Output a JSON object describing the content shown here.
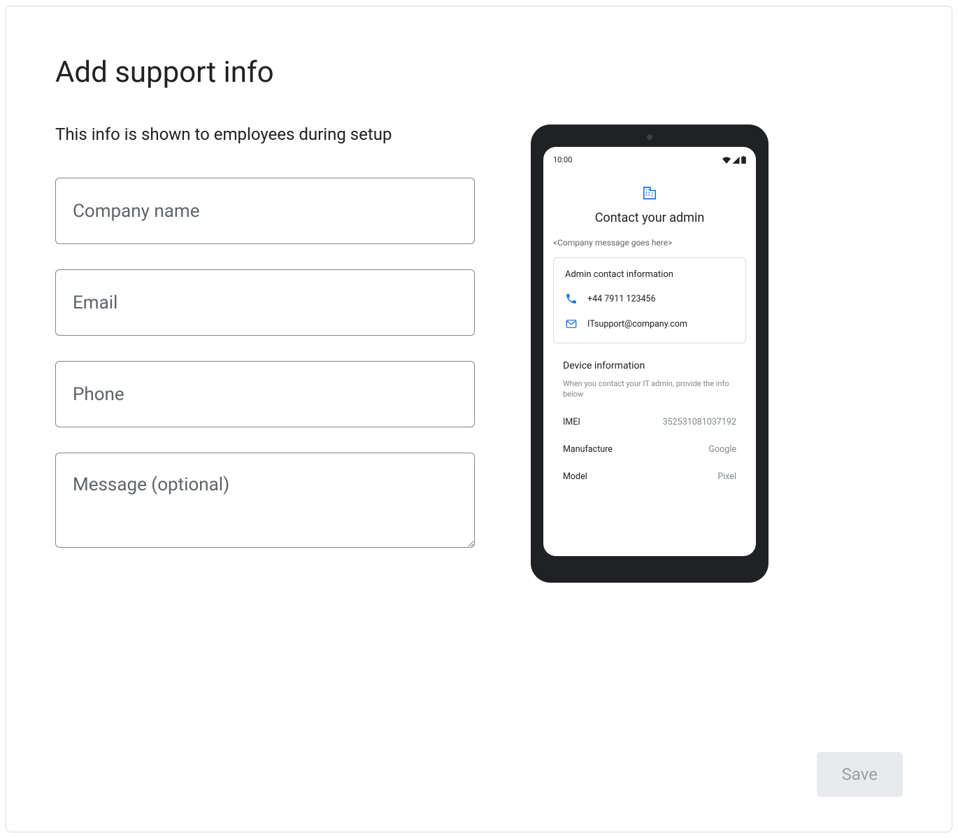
{
  "page": {
    "title": "Add support info",
    "subtitle": "This info is shown to employees during setup"
  },
  "form": {
    "company_placeholder": "Company name",
    "email_placeholder": "Email",
    "phone_placeholder": "Phone",
    "message_placeholder": "Message (optional)"
  },
  "preview": {
    "time": "10:00",
    "heading": "Contact your admin",
    "message_placeholder": "<Company message goes here>",
    "admin_box_title": "Admin contact information",
    "phone_value": "+44 7911 123456",
    "email_value": "ITsupport@company.com",
    "device_title": "Device information",
    "device_subtitle": "When you contact your IT admin, provide the info below",
    "rows": [
      {
        "label": "IMEI",
        "value": "352531081037192"
      },
      {
        "label": "Manufacture",
        "value": "Google"
      },
      {
        "label": "Model",
        "value": "Pixel"
      }
    ]
  },
  "actions": {
    "save_label": "Save"
  }
}
